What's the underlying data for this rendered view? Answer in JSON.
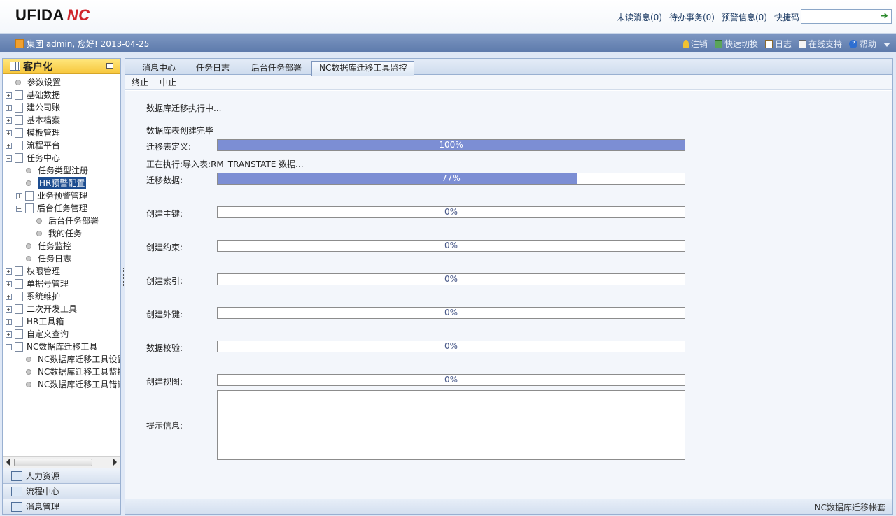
{
  "header": {
    "logo_text": "UFIDA",
    "logo_mark": "NC",
    "links": [
      "未读消息(0)",
      "待办事务(0)",
      "预警信息(0)",
      "快捷码"
    ],
    "quickcode_value": ""
  },
  "userbar": {
    "greeting": "集团 admin, 您好! 2013-04-25",
    "actions": {
      "logout": "注销",
      "switch": "快速切换",
      "log": "日志",
      "support": "在线支持",
      "help": "帮助"
    }
  },
  "sidebar": {
    "title": "客户化",
    "tree": [
      {
        "label": "参数设置",
        "type": "leaf",
        "level": 0
      },
      {
        "label": "基础数据",
        "type": "folder",
        "level": 0
      },
      {
        "label": "建公司账",
        "type": "folder",
        "level": 0
      },
      {
        "label": "基本档案",
        "type": "folder",
        "level": 0
      },
      {
        "label": "模板管理",
        "type": "folder",
        "level": 0
      },
      {
        "label": "流程平台",
        "type": "folder",
        "level": 0
      },
      {
        "label": "任务中心",
        "type": "folder-open",
        "level": 0
      },
      {
        "label": "任务类型注册",
        "type": "leaf",
        "level": 1
      },
      {
        "label": "HR预警配置",
        "type": "leaf",
        "level": 1,
        "selected": true
      },
      {
        "label": "业务预警管理",
        "type": "folder",
        "level": 1
      },
      {
        "label": "后台任务管理",
        "type": "folder-open",
        "level": 1
      },
      {
        "label": "后台任务部署",
        "type": "leaf",
        "level": 2
      },
      {
        "label": "我的任务",
        "type": "leaf",
        "level": 2
      },
      {
        "label": "任务监控",
        "type": "leaf",
        "level": 1
      },
      {
        "label": "任务日志",
        "type": "leaf",
        "level": 1
      },
      {
        "label": "权限管理",
        "type": "folder",
        "level": 0
      },
      {
        "label": "单据号管理",
        "type": "folder",
        "level": 0
      },
      {
        "label": "系统维护",
        "type": "folder",
        "level": 0
      },
      {
        "label": "二次开发工具",
        "type": "folder",
        "level": 0
      },
      {
        "label": "HR工具箱",
        "type": "folder",
        "level": 0
      },
      {
        "label": "自定义查询",
        "type": "folder",
        "level": 0
      },
      {
        "label": "NC数据库迁移工具",
        "type": "folder-open",
        "level": 0
      },
      {
        "label": "NC数据库迁移工具设置",
        "type": "leaf",
        "level": 1
      },
      {
        "label": "NC数据库迁移工具监控",
        "type": "leaf",
        "level": 1
      },
      {
        "label": "NC数据库迁移工具错误",
        "type": "leaf",
        "level": 1
      }
    ],
    "modules": [
      "人力资源",
      "流程中心",
      "消息管理"
    ]
  },
  "tabs": [
    "消息中心",
    "任务日志",
    "后台任务部署",
    "NC数据库迁移工具监控"
  ],
  "toolbar": {
    "terminate": "终止",
    "abort": "中止"
  },
  "monitor": {
    "status": "数据库迁移执行中...",
    "stage1_msg": "数据库表创建完毕",
    "stage2_msg": "正在执行:导入表:RM_TRANSTATE 数据...",
    "rows": [
      {
        "label": "迁移表定义:",
        "percent": 100,
        "text": "100%"
      },
      {
        "label": "迁移数据:",
        "percent": 77,
        "text": "77%"
      },
      {
        "label": "创建主键:",
        "percent": 0,
        "text": "0%"
      },
      {
        "label": "创建约束:",
        "percent": 0,
        "text": "0%"
      },
      {
        "label": "创建索引:",
        "percent": 0,
        "text": "0%"
      },
      {
        "label": "创建外键:",
        "percent": 0,
        "text": "0%"
      },
      {
        "label": "数据校验:",
        "percent": 0,
        "text": "0%"
      },
      {
        "label": "创建视图:",
        "percent": 0,
        "text": "0%"
      }
    ],
    "info_label": "提示信息:",
    "info_text": ""
  },
  "statusbar": {
    "text": "NC数据库迁移帐套"
  }
}
